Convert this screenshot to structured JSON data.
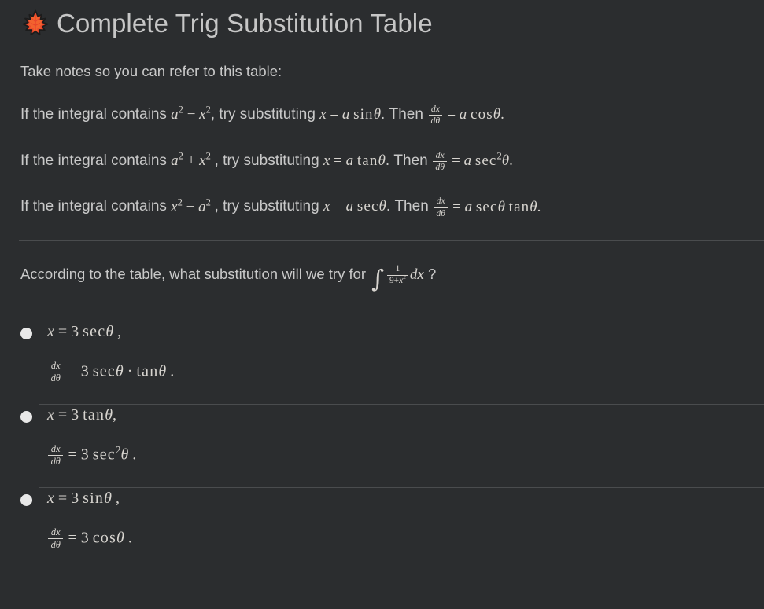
{
  "header": {
    "icon": "maple-leaf-icon",
    "title": "Complete Trig Substitution Table",
    "title_color": "#c6c6c6"
  },
  "intro": {
    "text": "Take notes so you can refer to this table:"
  },
  "colors": {
    "background": "#2b2d2f",
    "text": "#c9c9c9",
    "math": "#d7d4cf",
    "divider": "#4a4c4e",
    "radio": "#e8e8e8",
    "leaf_red": "#e8452c",
    "leaf_orange": "#f2622e"
  },
  "rules": [
    {
      "lead": "If the integral contains",
      "expr_base1": "a",
      "expr_sup1": "2",
      "expr_op": "−",
      "expr_base2": "x",
      "expr_sup2": "2",
      "comma": ",",
      "mid": "try substituting",
      "sub_x": "x",
      "sub_eq": "=",
      "sub_a": "a",
      "sub_fn": "sin",
      "sub_fn_sup": "",
      "sub_theta": "θ",
      "period1": ".",
      "then": "Then",
      "d_num": "dx",
      "d_den": "dθ",
      "d_eq": "=",
      "res_a": "a",
      "res_fn": "cos",
      "res_fn_sup": "",
      "res_theta": "θ",
      "res_extra_fn": "",
      "res_extra_theta": "",
      "period2": "."
    },
    {
      "lead": "If the integral contains",
      "expr_base1": "a",
      "expr_sup1": "2",
      "expr_op": "+",
      "expr_base2": "x",
      "expr_sup2": "2",
      "comma": ",",
      "mid": "try substituting",
      "sub_x": "x",
      "sub_eq": "=",
      "sub_a": "a",
      "sub_fn": "tan",
      "sub_fn_sup": "",
      "sub_theta": "θ",
      "period1": ".",
      "then": "Then",
      "d_num": "dx",
      "d_den": "dθ",
      "d_eq": "=",
      "res_a": "a",
      "res_fn": "sec",
      "res_fn_sup": "2",
      "res_theta": "θ",
      "res_extra_fn": "",
      "res_extra_theta": "",
      "period2": "."
    },
    {
      "lead": "If the integral contains",
      "expr_base1": "x",
      "expr_sup1": "2",
      "expr_op": "−",
      "expr_base2": "a",
      "expr_sup2": "2",
      "comma": ",",
      "mid": "try substituting",
      "sub_x": "x",
      "sub_eq": "=",
      "sub_a": "a",
      "sub_fn": "sec",
      "sub_fn_sup": "",
      "sub_theta": "θ",
      "period1": ".",
      "then": "Then",
      "d_num": "dx",
      "d_den": "dθ",
      "d_eq": "=",
      "res_a": "a",
      "res_fn": "sec",
      "res_fn_sup": "",
      "res_theta": "θ",
      "res_extra_fn": "tan",
      "res_extra_theta": "θ",
      "period2": "."
    }
  ],
  "question": {
    "text_before": "According to the table, what substitution will we try for",
    "integral_sign": "∫",
    "frac_num": "1",
    "frac_den_a": "9+",
    "frac_den_x": "x",
    "frac_den_sup": "2",
    "dx": "dx",
    "text_after": "?"
  },
  "options": [
    {
      "selected": false,
      "line1_x": "x",
      "line1_eq": "=",
      "line1_coef": "3",
      "line1_fn": "sec",
      "line1_fn_sup": "",
      "line1_theta": "θ",
      "line1_end": ",",
      "line2_num": "dx",
      "line2_den": "dθ",
      "line2_eq": "=",
      "line2_coef": "3",
      "line2_fn": "sec",
      "line2_fn_sup": "",
      "line2_theta": "θ",
      "line2_dot": "·",
      "line2_fn2": "tan",
      "line2_theta2": "θ",
      "line2_end": "."
    },
    {
      "selected": false,
      "line1_x": "x",
      "line1_eq": "=",
      "line1_coef": "3",
      "line1_fn": "tan",
      "line1_fn_sup": "",
      "line1_theta": "θ",
      "line1_end": ",",
      "line2_num": "dx",
      "line2_den": "dθ",
      "line2_eq": "=",
      "line2_coef": "3",
      "line2_fn": "sec",
      "line2_fn_sup": "2",
      "line2_theta": "θ",
      "line2_dot": "",
      "line2_fn2": "",
      "line2_theta2": "",
      "line2_end": "."
    },
    {
      "selected": false,
      "line1_x": "x",
      "line1_eq": "=",
      "line1_coef": "3",
      "line1_fn": "sin",
      "line1_fn_sup": "",
      "line1_theta": "θ",
      "line1_end": ",",
      "line2_num": "dx",
      "line2_den": "dθ",
      "line2_eq": "=",
      "line2_coef": "3",
      "line2_fn": "cos",
      "line2_fn_sup": "",
      "line2_theta": "θ",
      "line2_dot": "",
      "line2_fn2": "",
      "line2_theta2": "",
      "line2_end": "."
    }
  ]
}
